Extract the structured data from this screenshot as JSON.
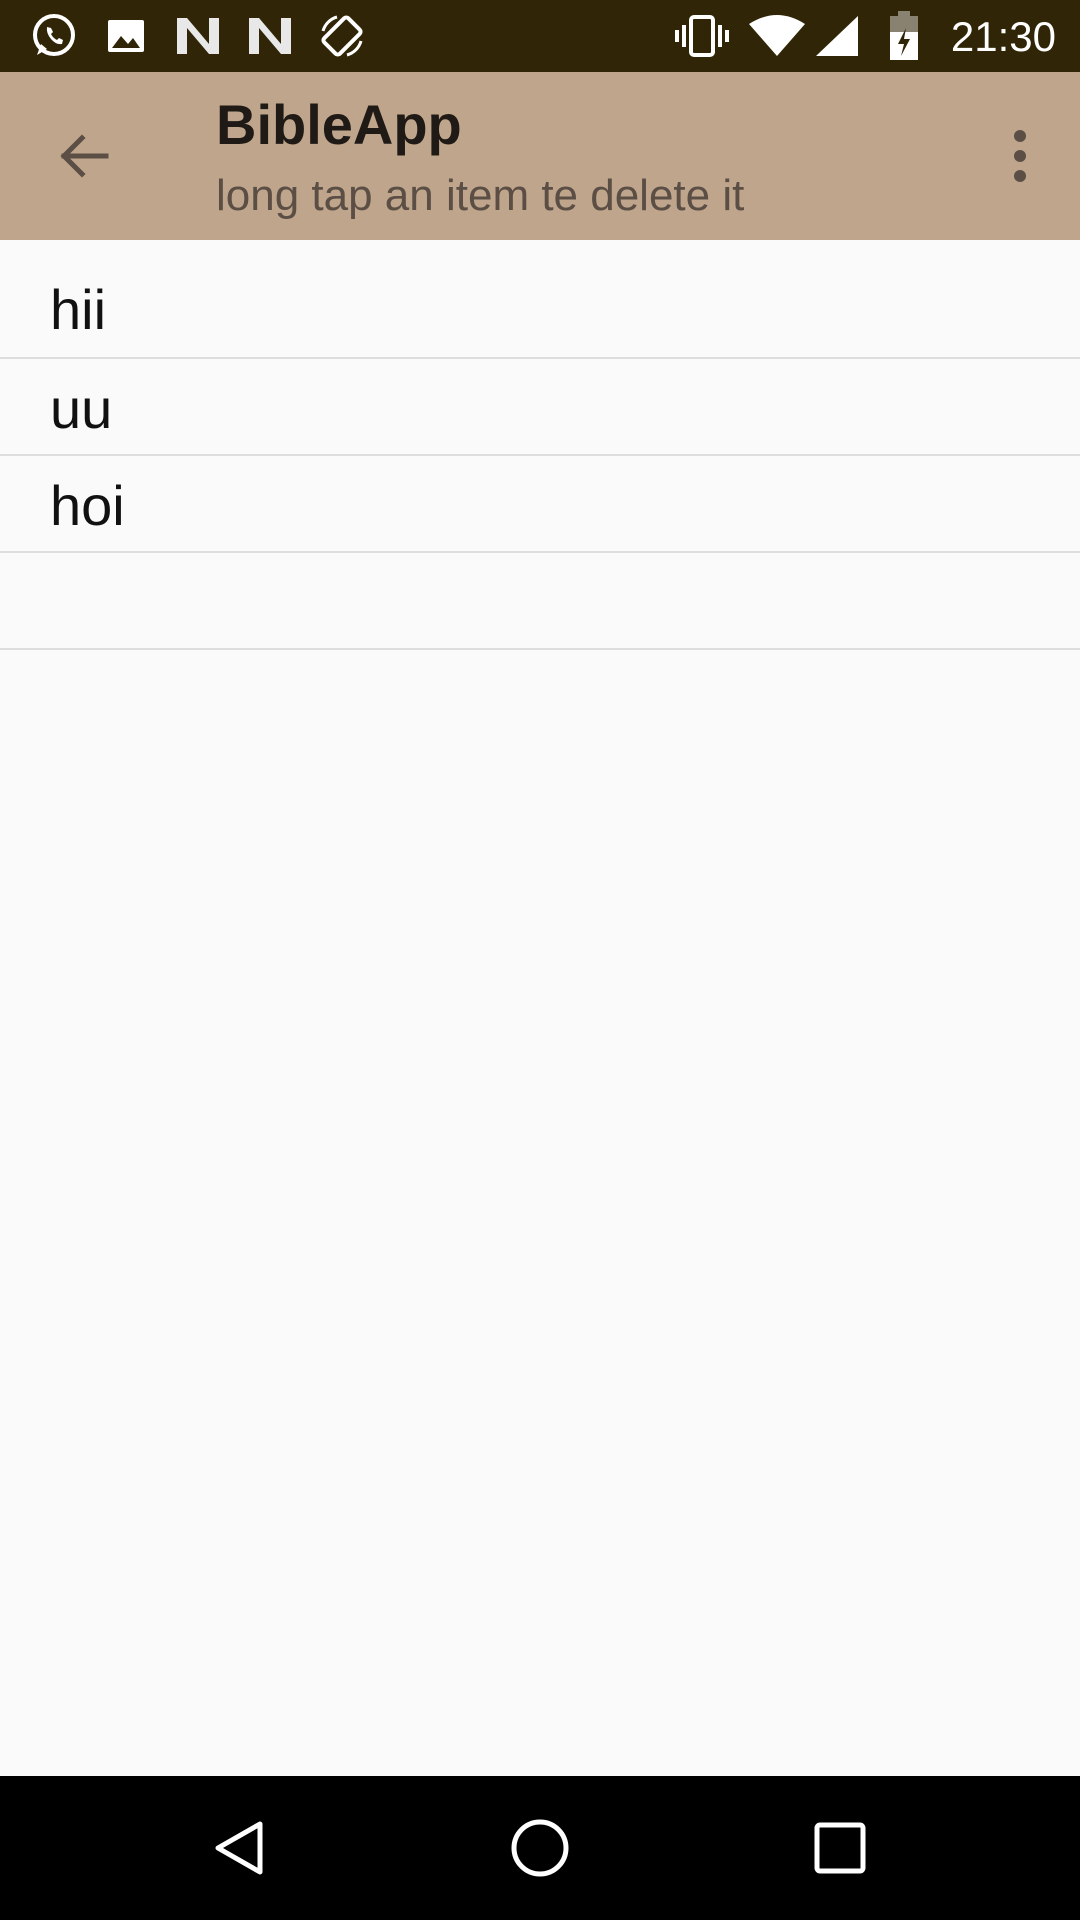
{
  "status_bar": {
    "time": "21:30",
    "left_icons": [
      "whatsapp-icon",
      "gallery-icon",
      "n-notification-icon",
      "n-notification-icon",
      "auto-rotate-icon"
    ],
    "right_icons": [
      "vibrate-icon",
      "wifi-icon",
      "signal-icon",
      "battery-charging-icon"
    ],
    "background": "#302607"
  },
  "app_bar": {
    "title": "BibleApp",
    "subtitle": "long tap an item te delete it",
    "back_icon": "arrow-back-icon",
    "overflow_icon": "more-vert-icon",
    "background": "#bfa58b"
  },
  "list": {
    "items": [
      {
        "label": "hii"
      },
      {
        "label": "uu"
      },
      {
        "label": "hoi"
      },
      {
        "label": ""
      }
    ]
  },
  "nav_bar": {
    "icons": [
      "back-triangle-icon",
      "home-circle-icon",
      "recents-square-icon"
    ],
    "background": "#000000"
  }
}
